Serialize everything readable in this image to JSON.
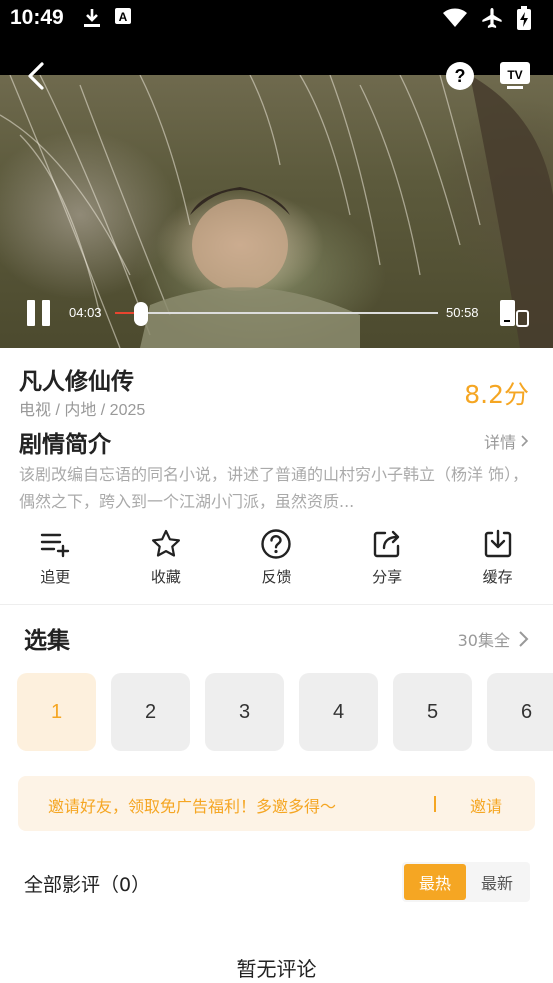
{
  "status": {
    "time": "10:49"
  },
  "player": {
    "current_time": "04:03",
    "total_time": "50:58",
    "progress": 0.08
  },
  "show": {
    "title": "凡人修仙传",
    "meta": "电视 / 内地 / 2025",
    "score": "8.2分"
  },
  "synopsis": {
    "heading": "剧情简介",
    "detail_label": "详情",
    "text": "该剧改编自忘语的同名小说，讲述了普通的山村穷小子韩立（杨洋 饰），偶然之下，跨入到一个江湖小门派，虽然资质..."
  },
  "actions": [
    {
      "label": "追更",
      "icon": "follow-icon"
    },
    {
      "label": "收藏",
      "icon": "star-icon"
    },
    {
      "label": "反馈",
      "icon": "question-icon"
    },
    {
      "label": "分享",
      "icon": "share-icon"
    },
    {
      "label": "缓存",
      "icon": "download-icon"
    }
  ],
  "episodes": {
    "heading": "选集",
    "total_label": "30集全",
    "items": [
      "1",
      "2",
      "3",
      "4",
      "5",
      "6"
    ],
    "selected": "1"
  },
  "invite": {
    "text": "邀请好友，领取免广告福利！多邀多得～",
    "button": "邀请"
  },
  "reviews": {
    "heading": "全部影评（0）",
    "sort_hot": "最热",
    "sort_new": "最新",
    "empty": "暂无评论"
  },
  "colors": {
    "accent": "#f5a623",
    "seek": "#e8452f"
  }
}
